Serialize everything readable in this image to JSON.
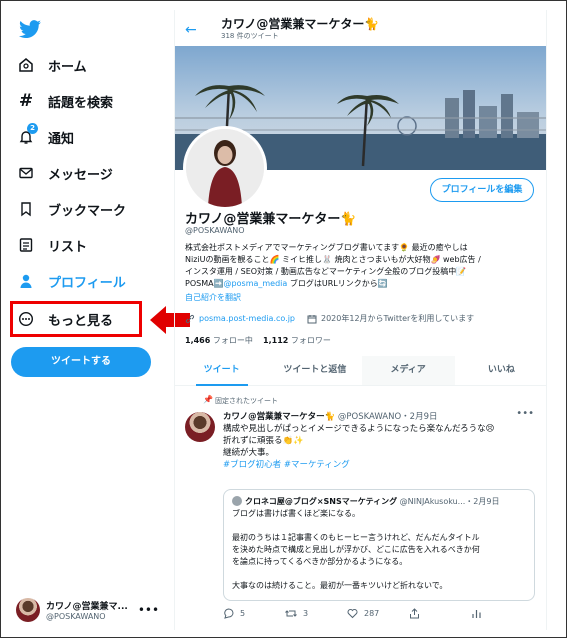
{
  "sidebar": {
    "items": [
      {
        "label": "ホーム",
        "icon": "home-icon"
      },
      {
        "label": "話題を検索",
        "icon": "hashtag-icon"
      },
      {
        "label": "通知",
        "icon": "bell-icon",
        "badge": "2"
      },
      {
        "label": "メッセージ",
        "icon": "mail-icon"
      },
      {
        "label": "ブックマーク",
        "icon": "bookmark-icon"
      },
      {
        "label": "リスト",
        "icon": "list-icon"
      },
      {
        "label": "プロフィール",
        "icon": "person-icon"
      },
      {
        "label": "もっと見る",
        "icon": "more-circle-icon"
      }
    ],
    "tweet_button": "ツイートする",
    "account": {
      "name": "カワノ@営業兼マ...",
      "handle": "@POSKAWANO"
    }
  },
  "header": {
    "title": "カワノ@営業兼マーケター🐈",
    "subtitle": "318 件のツイート"
  },
  "profile": {
    "edit_button": "プロフィールを編集",
    "name": "カワノ@営業兼マーケター🐈",
    "handle": "@POSKAWANO",
    "bio": [
      "株式会社ポストメディアでマーケティングブログ書いてます🌻 最近の癒やしは",
      "NiziUの動画を観ること🌈 ミイヒ推し🐰 焼肉とさつまいもが大好物🍠 web広告 /",
      "インスタ運用 / SEO対策 / 動画広告などマーケティング全般のブログ投稿中📝",
      "POSMA➡️",
      "@posma_media",
      "ブログはURLリンクから🔄"
    ],
    "translate": "自己紹介を翻訳",
    "link": "posma.post-media.co.jp",
    "joined": "2020年12月からTwitterを利用しています",
    "following_count": "1,466",
    "following_label": "フォロー中",
    "followers_count": "1,112",
    "followers_label": "フォロワー"
  },
  "tabs": [
    "ツイート",
    "ツイートと返信",
    "メディア",
    "いいね"
  ],
  "tweet": {
    "pinned_label": "固定されたツイート",
    "author": "カワノ@営業兼マーケター🐈",
    "handle_date": "@POSKAWANO・2月9日",
    "lines": [
      "構成や見出しがぱっとイメージできるようになったら楽なんだろうな😣",
      "折れずに頑張る👏✨",
      "継続が大事。"
    ],
    "hashtags": "#ブログ初心者 #マーケティング",
    "quote": {
      "author": "クロネコ屋@ブログ×SNSマーケティング",
      "handle_date": "@NINJAkusoku...・2月9日",
      "lines": [
        "ブログは書けば書くほど楽になる。",
        "",
        "最初のうちは１記事書くのもヒーヒー言うけれど、だんだんタイトル",
        "を決めた時点で構成と見出しが浮かび、どこに広告を入れるべきか何",
        "を論点に持ってくるべきか部分かるようになる。",
        "",
        "大事なのは続けること。最初が一番キツいけど折れないで。"
      ]
    },
    "replies": "5",
    "retweets": "3",
    "likes": "287"
  },
  "colors": {
    "accent": "#1d9bf0",
    "highlight": "#e00000"
  }
}
